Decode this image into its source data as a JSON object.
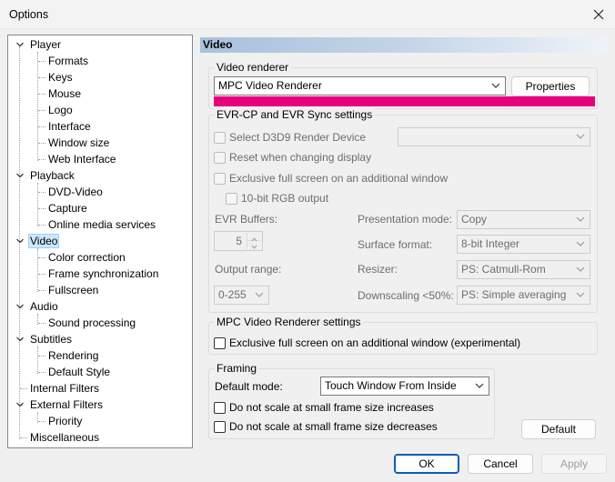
{
  "window": {
    "title": "Options"
  },
  "tree": {
    "items": [
      {
        "label": "Player"
      },
      {
        "label": "Formats"
      },
      {
        "label": "Keys"
      },
      {
        "label": "Mouse"
      },
      {
        "label": "Logo"
      },
      {
        "label": "Interface"
      },
      {
        "label": "Window size"
      },
      {
        "label": "Web Interface"
      },
      {
        "label": "Playback"
      },
      {
        "label": "DVD-Video"
      },
      {
        "label": "Capture"
      },
      {
        "label": "Online media services"
      },
      {
        "label": "Video"
      },
      {
        "label": "Color correction"
      },
      {
        "label": "Frame synchronization"
      },
      {
        "label": "Fullscreen"
      },
      {
        "label": "Audio"
      },
      {
        "label": "Sound processing"
      },
      {
        "label": "Subtitles"
      },
      {
        "label": "Rendering"
      },
      {
        "label": "Default Style"
      },
      {
        "label": "Internal Filters"
      },
      {
        "label": "External Filters"
      },
      {
        "label": "Priority"
      },
      {
        "label": "Miscellaneous"
      }
    ],
    "selected": "Video"
  },
  "page": {
    "title": "Video",
    "video_renderer": {
      "legend": "Video renderer",
      "selected": "MPC Video Renderer",
      "properties_button": "Properties"
    },
    "evr": {
      "legend": "EVR-CP and EVR Sync settings",
      "select_d3d9": "Select D3D9 Render Device",
      "reset_on_change": "Reset when changing display",
      "exclusive_fullscreen": "Exclusive full screen on an additional window",
      "rgb10": "10-bit RGB output",
      "evr_buffers_label": "EVR Buffers:",
      "evr_buffers_value": "5",
      "output_range_label": "Output range:",
      "output_range_value": "0-255",
      "presentation_mode_label": "Presentation mode:",
      "presentation_mode_value": "Copy",
      "surface_format_label": "Surface format:",
      "surface_format_value": "8-bit Integer",
      "resizer_label": "Resizer:",
      "resizer_value": "PS: Catmull-Rom",
      "downscaling_label": "Downscaling <50%:",
      "downscaling_value": "PS: Simple averaging"
    },
    "mpc_vr": {
      "legend": "MPC Video Renderer settings",
      "exclusive_fullscreen": "Exclusive full screen on an additional window (experimental)"
    },
    "framing": {
      "legend": "Framing",
      "default_mode_label": "Default mode:",
      "default_mode_value": "Touch Window From Inside",
      "no_scale_increase": "Do not scale at small frame size increases",
      "no_scale_decrease": "Do not scale at small frame size decreases"
    },
    "default_button": "Default"
  },
  "footer": {
    "ok": "OK",
    "cancel": "Cancel",
    "apply": "Apply"
  },
  "colors": {
    "highlight_bar": "#e6007e",
    "selection": "#cce8ff",
    "primary_border": "#005fb8"
  }
}
